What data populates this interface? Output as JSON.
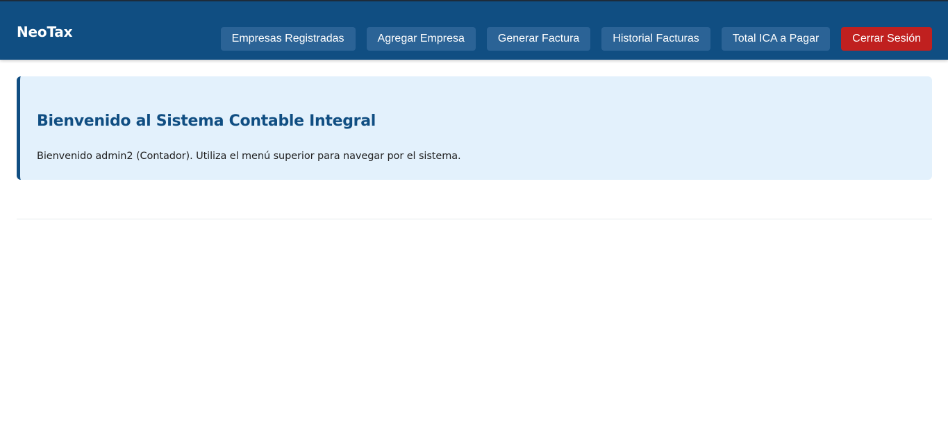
{
  "header": {
    "brand": "NeoTax",
    "nav": {
      "empresas_registradas": "Empresas Registradas",
      "agregar_empresa": "Agregar Empresa",
      "generar_factura": "Generar Factura",
      "historial_facturas": "Historial Facturas",
      "total_ica": "Total ICA a Pagar",
      "cerrar_sesion": "Cerrar Sesión"
    }
  },
  "main": {
    "welcome_title": "Bienvenido al Sistema Contable Integral",
    "welcome_text": "Bienvenido admin2 (Contador). Utiliza el menú superior para navegar por el sistema."
  },
  "colors": {
    "header_bg": "#104e82",
    "nav_button_bg": "#2b6396",
    "logout_bg": "#c0201f",
    "card_bg": "#e3f1fc",
    "accent": "#104e82"
  }
}
